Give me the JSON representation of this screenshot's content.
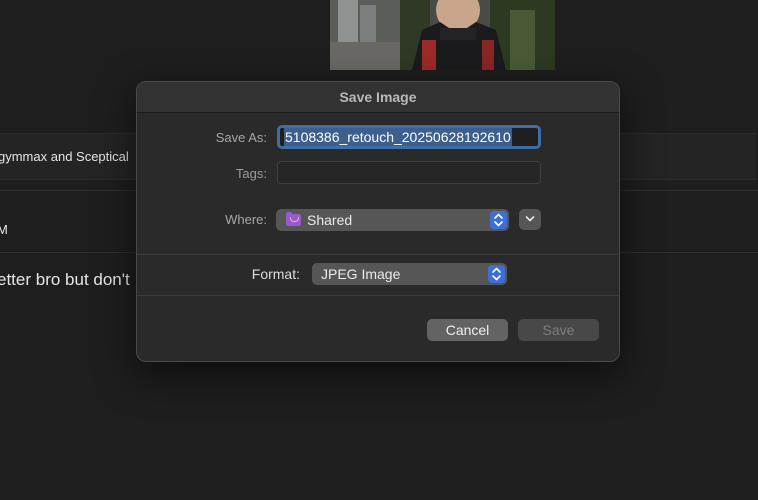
{
  "background": {
    "row1_text": "gymmax and Sceptical",
    "row2_text": "M",
    "row3_text": "etter bro but don't"
  },
  "dialog": {
    "title": "Save Image",
    "save_as": {
      "label": "Save As:",
      "value": "5108386_retouch_20250628192610"
    },
    "tags": {
      "label": "Tags:",
      "value": ""
    },
    "where": {
      "label": "Where:",
      "value": "Shared",
      "icon": "folder-icon"
    },
    "format": {
      "label": "Format:",
      "value": "JPEG Image"
    },
    "buttons": {
      "cancel": "Cancel",
      "save": "Save"
    }
  },
  "colors": {
    "accent": "#3d6fd6",
    "folder": "#9b59d0",
    "focus_ring": "#3e6ea3"
  }
}
